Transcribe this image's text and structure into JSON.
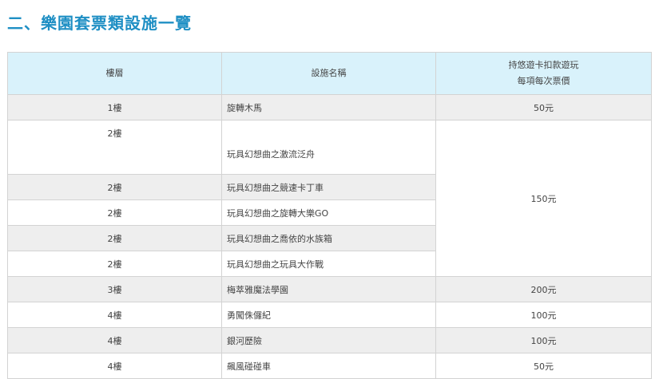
{
  "section_title": "二、樂園套票類設施一覽",
  "table": {
    "headers": {
      "floor": "樓層",
      "facility": "設施名稱",
      "price_line1": "持悠遊卡扣款遊玩",
      "price_line2": "每項每次票價"
    },
    "rows": [
      {
        "floor": "1樓",
        "name": "旋轉木馬",
        "price": "50元"
      },
      {
        "floor": "2樓",
        "name": "玩具幻想曲之激流泛舟"
      },
      {
        "floor": "2樓",
        "name": "玩具幻想曲之競速卡丁車"
      },
      {
        "floor": "2樓",
        "name": "玩具幻想曲之旋轉大樂GO"
      },
      {
        "floor": "2樓",
        "name": "玩具幻想曲之喬依的水族箱"
      },
      {
        "floor": "2樓",
        "name": "玩具幻想曲之玩具大作戰"
      },
      {
        "floor": "3樓",
        "name": "梅萃雅魔法學園",
        "price": "200元"
      },
      {
        "floor": "4樓",
        "name": "勇闖侏儸紀",
        "price": "100元"
      },
      {
        "floor": "4樓",
        "name": "銀河歷險",
        "price": "100元"
      },
      {
        "floor": "4樓",
        "name": "飆風碰碰車",
        "price": "50元"
      }
    ],
    "shared_price": "150元"
  },
  "colors": {
    "title": "#1f8fc4",
    "header_bg": "#d9f2fb",
    "row_shade": "#eeeeee",
    "border": "#d3d3d3"
  }
}
